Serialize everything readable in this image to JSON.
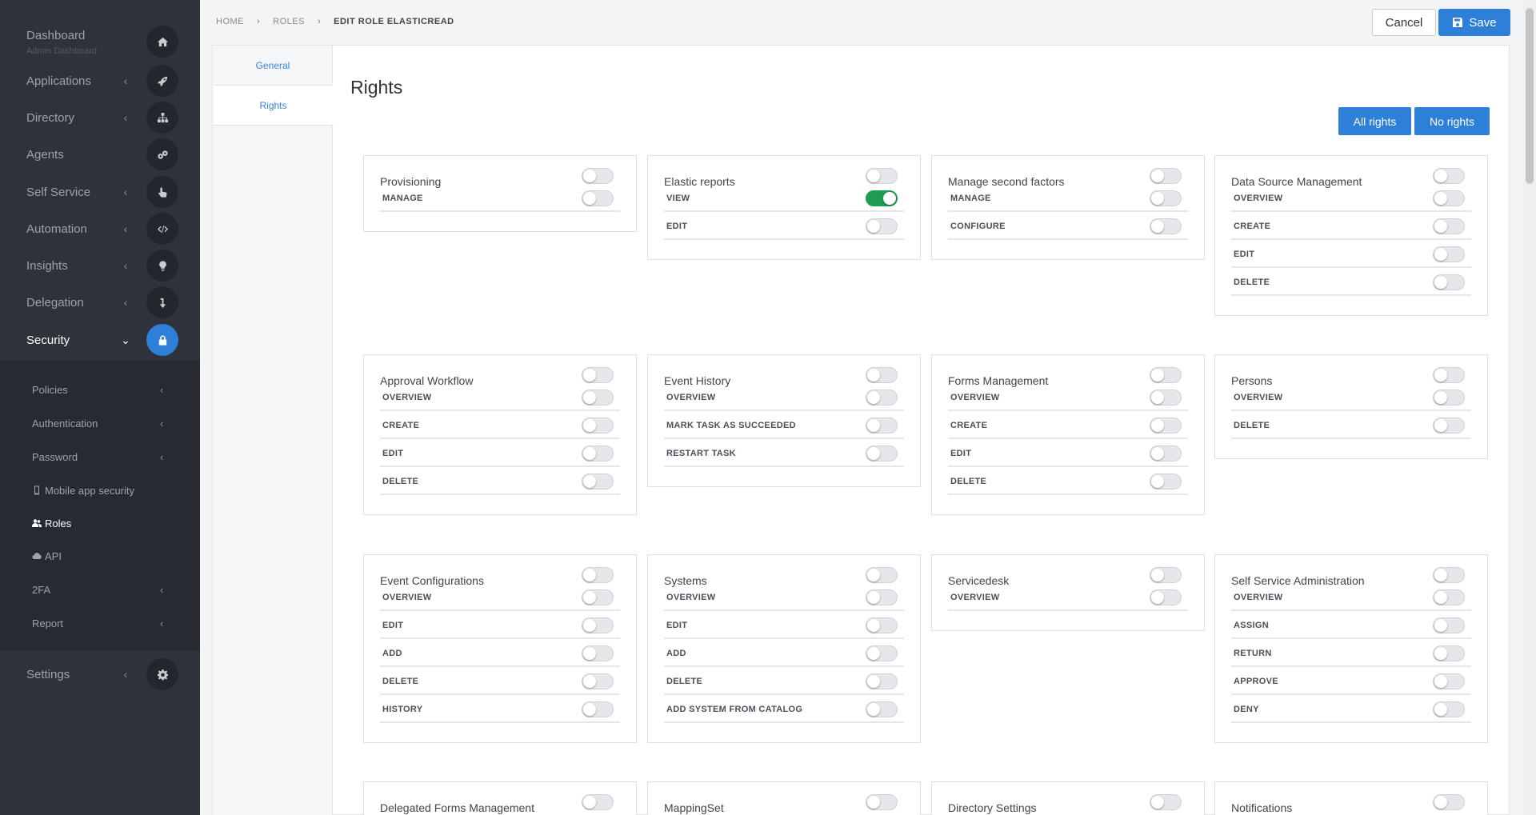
{
  "sidebar": {
    "items": [
      {
        "label": "Dashboard",
        "sub": "Admin Dashboard",
        "icon": "home-icon"
      },
      {
        "label": "Applications",
        "chevron": "‹",
        "icon": "rocket-icon"
      },
      {
        "label": "Directory",
        "chevron": "‹",
        "icon": "sitemap-icon"
      },
      {
        "label": "Agents",
        "icon": "cogs-icon"
      },
      {
        "label": "Self Service",
        "chevron": "‹",
        "icon": "hand-pointer-icon"
      },
      {
        "label": "Automation",
        "chevron": "‹",
        "icon": "code-icon"
      },
      {
        "label": "Insights",
        "chevron": "‹",
        "icon": "lightbulb-icon"
      },
      {
        "label": "Delegation",
        "chevron": "‹",
        "icon": "arrow-down-icon"
      },
      {
        "label": "Security",
        "chevron": "⌄",
        "icon": "lock-icon"
      },
      {
        "label": "Settings",
        "chevron": "‹",
        "icon": "gear-icon"
      }
    ],
    "submenu": [
      {
        "label": "Policies",
        "chevron": "‹"
      },
      {
        "label": "Authentication",
        "chevron": "‹"
      },
      {
        "label": "Password",
        "chevron": "‹"
      },
      {
        "label": "Mobile app security",
        "icon": "mobile-icon"
      },
      {
        "label": "Roles",
        "icon": "users-icon"
      },
      {
        "label": "API",
        "icon": "cloud-icon"
      },
      {
        "label": "2FA",
        "chevron": "‹"
      },
      {
        "label": "Report",
        "chevron": "‹"
      }
    ]
  },
  "breadcrumb": {
    "home": "HOME",
    "roles": "ROLES",
    "current": "EDIT ROLE ELASTICREAD",
    "separator": "›"
  },
  "actions": {
    "cancel": "Cancel",
    "save": "Save"
  },
  "tabs": {
    "general": "General",
    "rights": "Rights"
  },
  "content": {
    "title": "Rights",
    "all_rights": "All rights",
    "no_rights": "No rights"
  },
  "colors": {
    "accent": "#2d7fd8",
    "toggle_on": "#1f9d55",
    "sidebar": "#2e323a"
  },
  "cards": [
    {
      "title": "Provisioning",
      "on": false,
      "rows": [
        {
          "label": "MANAGE",
          "on": false
        }
      ]
    },
    {
      "title": "Elastic reports",
      "on": false,
      "rows": [
        {
          "label": "VIEW",
          "on": true
        },
        {
          "label": "EDIT",
          "on": false
        }
      ]
    },
    {
      "title": "Manage second factors",
      "on": false,
      "rows": [
        {
          "label": "MANAGE",
          "on": false
        },
        {
          "label": "CONFIGURE",
          "on": false
        }
      ]
    },
    {
      "title": "Data Source Management",
      "on": false,
      "rows": [
        {
          "label": "OVERVIEW",
          "on": false
        },
        {
          "label": "CREATE",
          "on": false
        },
        {
          "label": "EDIT",
          "on": false
        },
        {
          "label": "DELETE",
          "on": false
        }
      ]
    },
    {
      "title": "Approval Workflow",
      "on": false,
      "rows": [
        {
          "label": "OVERVIEW",
          "on": false
        },
        {
          "label": "CREATE",
          "on": false
        },
        {
          "label": "EDIT",
          "on": false
        },
        {
          "label": "DELETE",
          "on": false
        }
      ]
    },
    {
      "title": "Event History",
      "on": false,
      "rows": [
        {
          "label": "OVERVIEW",
          "on": false
        },
        {
          "label": "MARK TASK AS SUCCEEDED",
          "on": false
        },
        {
          "label": "RESTART TASK",
          "on": false
        }
      ]
    },
    {
      "title": "Forms Management",
      "on": false,
      "rows": [
        {
          "label": "OVERVIEW",
          "on": false
        },
        {
          "label": "CREATE",
          "on": false
        },
        {
          "label": "EDIT",
          "on": false
        },
        {
          "label": "DELETE",
          "on": false
        }
      ]
    },
    {
      "title": "Persons",
      "on": false,
      "rows": [
        {
          "label": "OVERVIEW",
          "on": false
        },
        {
          "label": "DELETE",
          "on": false
        }
      ]
    },
    {
      "title": "Event Configurations",
      "on": false,
      "rows": [
        {
          "label": "OVERVIEW",
          "on": false
        },
        {
          "label": "EDIT",
          "on": false
        },
        {
          "label": "ADD",
          "on": false
        },
        {
          "label": "DELETE",
          "on": false
        },
        {
          "label": "HISTORY",
          "on": false
        }
      ]
    },
    {
      "title": "Systems",
      "on": false,
      "rows": [
        {
          "label": "OVERVIEW",
          "on": false
        },
        {
          "label": "EDIT",
          "on": false
        },
        {
          "label": "ADD",
          "on": false
        },
        {
          "label": "DELETE",
          "on": false
        },
        {
          "label": "ADD SYSTEM FROM CATALOG",
          "on": false
        }
      ]
    },
    {
      "title": "Servicedesk",
      "on": false,
      "rows": [
        {
          "label": "OVERVIEW",
          "on": false
        }
      ]
    },
    {
      "title": "Self Service Administration",
      "on": false,
      "rows": [
        {
          "label": "OVERVIEW",
          "on": false
        },
        {
          "label": "ASSIGN",
          "on": false
        },
        {
          "label": "RETURN",
          "on": false
        },
        {
          "label": "APPROVE",
          "on": false
        },
        {
          "label": "DENY",
          "on": false
        }
      ]
    },
    {
      "title": "Delegated Forms Management",
      "on": false,
      "rows": []
    },
    {
      "title": "MappingSet",
      "on": false,
      "rows": []
    },
    {
      "title": "Directory Settings",
      "on": false,
      "rows": []
    },
    {
      "title": "Notifications",
      "on": false,
      "rows": []
    }
  ]
}
